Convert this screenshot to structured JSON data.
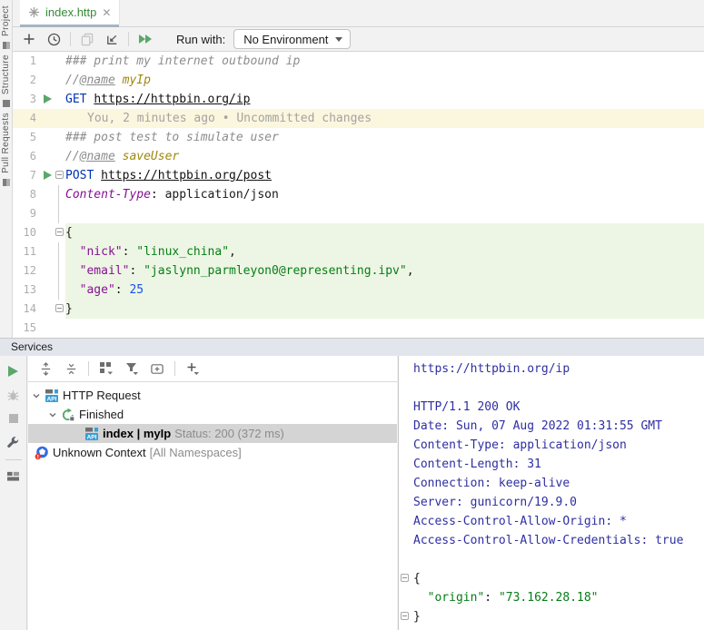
{
  "window": {
    "tab_title": "index.http"
  },
  "left_stripe": {
    "items": [
      "Project",
      "Structure",
      "Pull Requests"
    ]
  },
  "run_toolbar": {
    "run_with_label": "Run with:",
    "environment": "No Environment"
  },
  "editor": {
    "lines": [
      {
        "num": 1,
        "seg": [
          {
            "t": "### print my internet outbound ip",
            "c": "cm"
          }
        ]
      },
      {
        "num": 2,
        "seg": [
          {
            "t": "//",
            "c": "cm"
          },
          {
            "t": "@name",
            "c": "ann"
          },
          {
            "t": " ",
            "c": "cm"
          },
          {
            "t": "myIp",
            "c": "name"
          }
        ]
      },
      {
        "num": 3,
        "run": true,
        "seg": [
          {
            "t": "GET ",
            "c": "kw"
          },
          {
            "t": "https://httpbin.org/ip",
            "c": "url"
          }
        ]
      },
      {
        "num": 4,
        "bg": "yellow",
        "seg": [
          {
            "t": "You, 2 minutes ago • Uncommitted changes",
            "c": "blame"
          }
        ]
      },
      {
        "num": 5,
        "seg": [
          {
            "t": "### post test to simulate user",
            "c": "cm"
          }
        ]
      },
      {
        "num": 6,
        "seg": [
          {
            "t": "//",
            "c": "cm"
          },
          {
            "t": "@name",
            "c": "ann"
          },
          {
            "t": " ",
            "c": "cm"
          },
          {
            "t": "saveUser",
            "c": "name"
          }
        ]
      },
      {
        "num": 7,
        "run": true,
        "fold": "start",
        "seg": [
          {
            "t": "POST ",
            "c": "kw"
          },
          {
            "t": "https://httpbin.org/post",
            "c": "url"
          }
        ]
      },
      {
        "num": 8,
        "fl": true,
        "seg": [
          {
            "t": "Content-Type",
            "c": "hdr"
          },
          {
            "t": ": "
          },
          {
            "t": "application/json"
          }
        ]
      },
      {
        "num": 9,
        "fl": true,
        "seg": []
      },
      {
        "num": 10,
        "fold": "start",
        "bg": "green",
        "seg": [
          {
            "t": "{"
          }
        ]
      },
      {
        "num": 11,
        "fl": true,
        "bg": "green",
        "seg": [
          {
            "t": "  "
          },
          {
            "t": "\"nick\"",
            "c": "key"
          },
          {
            "t": ": "
          },
          {
            "t": "\"linux_china\"",
            "c": "str"
          },
          {
            "t": ","
          }
        ]
      },
      {
        "num": 12,
        "fl": true,
        "bg": "green",
        "seg": [
          {
            "t": "  "
          },
          {
            "t": "\"email\"",
            "c": "key"
          },
          {
            "t": ": "
          },
          {
            "t": "\"jaslynn_parmleyon0@representing.ipv\"",
            "c": "str"
          },
          {
            "t": ","
          }
        ]
      },
      {
        "num": 13,
        "fl": true,
        "bg": "green",
        "seg": [
          {
            "t": "  "
          },
          {
            "t": "\"age\"",
            "c": "key"
          },
          {
            "t": ": "
          },
          {
            "t": "25",
            "c": "num"
          }
        ]
      },
      {
        "num": 14,
        "fold": "end",
        "bg": "green",
        "seg": [
          {
            "t": "}"
          }
        ]
      },
      {
        "num": 15,
        "seg": []
      }
    ]
  },
  "services": {
    "title": "Services",
    "tree": {
      "root": {
        "label": "HTTP Request"
      },
      "group": {
        "label": "Finished"
      },
      "request": {
        "label": "index | myIp",
        "status": "Status: 200 (372 ms)"
      },
      "context": {
        "label": "Unknown Context",
        "suffix": "[All Namespaces]"
      }
    },
    "console": {
      "lines": [
        {
          "seg": [
            {
              "t": "https://httpbin.org/ip",
              "c": "blu"
            }
          ]
        },
        {
          "seg": []
        },
        {
          "seg": [
            {
              "t": "HTTP/1.1 200 OK",
              "c": "blu"
            }
          ]
        },
        {
          "seg": [
            {
              "t": "Date: Sun, 07 Aug 2022 01:31:55 GMT",
              "c": "blu"
            }
          ]
        },
        {
          "seg": [
            {
              "t": "Content-Type: application/json",
              "c": "blu"
            }
          ]
        },
        {
          "seg": [
            {
              "t": "Content-Length: 31",
              "c": "blu"
            }
          ]
        },
        {
          "seg": [
            {
              "t": "Connection: keep-alive",
              "c": "blu"
            }
          ]
        },
        {
          "seg": [
            {
              "t": "Server: gunicorn/19.9.0",
              "c": "blu"
            }
          ]
        },
        {
          "seg": [
            {
              "t": "Access-Control-Allow-Origin: *",
              "c": "blu"
            }
          ]
        },
        {
          "seg": [
            {
              "t": "Access-Control-Allow-Credentials: true",
              "c": "blu"
            }
          ]
        },
        {
          "seg": []
        },
        {
          "fold": "start",
          "seg": [
            {
              "t": "{",
              "c": "blk"
            }
          ]
        },
        {
          "seg": [
            {
              "t": "  ",
              "c": "blk"
            },
            {
              "t": "\"origin\"",
              "c": "grn"
            },
            {
              "t": ": ",
              "c": "blk"
            },
            {
              "t": "\"73.162.28.18\"",
              "c": "grn"
            }
          ]
        },
        {
          "fold": "end",
          "seg": [
            {
              "t": "}",
              "c": "blk"
            }
          ]
        }
      ]
    }
  },
  "colors": {
    "accent_green": "#59A869",
    "console_blue": "#2E2EA2",
    "string_green": "#067D17",
    "keyword_blue": "#0033B3",
    "key_purple": "#871094",
    "tab_title_green": "#368C36",
    "selection_gray": "#D4D4D4"
  }
}
